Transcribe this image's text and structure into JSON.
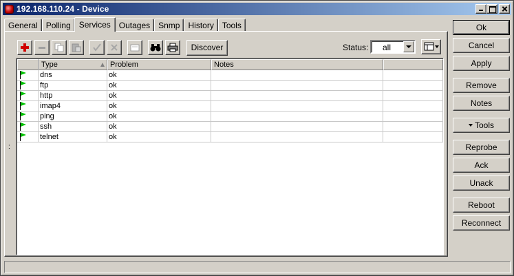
{
  "window": {
    "title": "192.168.110.24 - Device"
  },
  "tabs": [
    {
      "label": "General",
      "active": false
    },
    {
      "label": "Polling",
      "active": false
    },
    {
      "label": "Services",
      "active": true
    },
    {
      "label": "Outages",
      "active": false
    },
    {
      "label": "Snmp",
      "active": false
    },
    {
      "label": "History",
      "active": false
    },
    {
      "label": "Tools",
      "active": false
    }
  ],
  "toolbar": {
    "icons": [
      "add-icon",
      "remove-icon",
      "copy-icon",
      "paste-icon",
      "check-icon",
      "cross-icon",
      "comment-icon",
      "find-icon",
      "print-icon"
    ],
    "discover_label": "Discover",
    "status_label": "Status:",
    "status_value": "all"
  },
  "table": {
    "columns": [
      "",
      "Type",
      "Problem",
      "Notes",
      ""
    ],
    "rows": [
      {
        "type": "dns",
        "problem": "ok",
        "notes": ""
      },
      {
        "type": "ftp",
        "problem": "ok",
        "notes": ""
      },
      {
        "type": "http",
        "problem": "ok",
        "notes": ""
      },
      {
        "type": "imap4",
        "problem": "ok",
        "notes": ""
      },
      {
        "type": "ping",
        "problem": "ok",
        "notes": ""
      },
      {
        "type": "ssh",
        "problem": "ok",
        "notes": ""
      },
      {
        "type": "telnet",
        "problem": "ok",
        "notes": ""
      }
    ]
  },
  "side_buttons": {
    "ok": "Ok",
    "cancel": "Cancel",
    "apply": "Apply",
    "remove": "Remove",
    "notes": "Notes",
    "tools": "Tools",
    "reprobe": "Reprobe",
    "ack": "Ack",
    "unack": "Unack",
    "reboot": "Reboot",
    "reconnect": "Reconnect"
  },
  "colors": {
    "titlebar_start": "#0a246a",
    "titlebar_end": "#a6caf0",
    "face": "#d4d0c8",
    "flag_green": "#00c000"
  }
}
